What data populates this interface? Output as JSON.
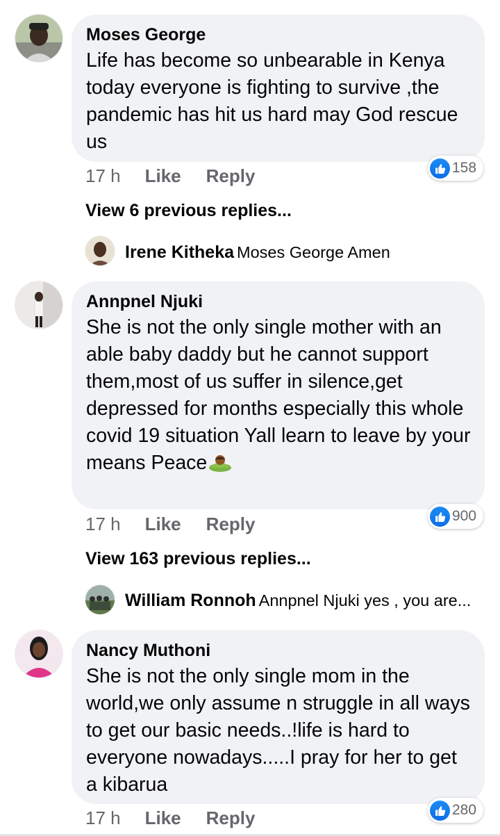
{
  "comments": [
    {
      "author": "Moses George",
      "text": "Life has become so unbearable in Kenya today everyone is fighting to survive ,the pandemic has hit us hard may God rescue us",
      "time": "17 h",
      "like_label": "Like",
      "reply_label": "Reply",
      "reaction_count": "158",
      "view_replies": "View 6 previous replies...",
      "latest_reply": {
        "author": "Irene Kitheka",
        "text": "Moses George Amen"
      }
    },
    {
      "author": "Annpnel Njuki",
      "text": "She is not the only single mother with an able baby daddy but he cannot support them,most of us suffer in silence,get depressed for months especially this whole covid 19 situation Yall learn to leave by your means Peace",
      "emoji_icon": "person-bowing-emoji",
      "time": "17 h",
      "like_label": "Like",
      "reply_label": "Reply",
      "reaction_count": "900",
      "view_replies": "View 163 previous replies...",
      "latest_reply": {
        "author": "William Ronnoh",
        "text": "Annpnel Njuki yes , you are..."
      }
    },
    {
      "author": "Nancy Muthoni",
      "text": "She is not the only single mom in the world,we only assume n struggle in all ways to get our basic needs..!life is hard to everyone nowadays.....I pray for her to get a kibarua",
      "time": "17 h",
      "like_label": "Like",
      "reply_label": "Reply",
      "reaction_count": "280"
    }
  ],
  "colors": {
    "bubble": "#f0f2f5",
    "meta_text": "#65676b",
    "like_blue": "#1877f2"
  },
  "icons": {
    "reaction": "thumbs-up-icon"
  }
}
